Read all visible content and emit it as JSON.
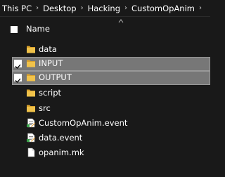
{
  "breadcrumb": {
    "items": [
      "This PC",
      "Desktop",
      "Hacking",
      "CustomOpAnim"
    ],
    "separator": "›"
  },
  "header": {
    "name_label": "Name"
  },
  "files": [
    {
      "name": "data",
      "type": "folder",
      "selected": false
    },
    {
      "name": "INPUT",
      "type": "folder",
      "selected": true
    },
    {
      "name": "OUTPUT",
      "type": "folder",
      "selected": true
    },
    {
      "name": "script",
      "type": "folder",
      "selected": false
    },
    {
      "name": "src",
      "type": "folder",
      "selected": false
    },
    {
      "name": "CustomOpAnim.event",
      "type": "event-file",
      "selected": false
    },
    {
      "name": "data.event",
      "type": "event-file",
      "selected": false
    },
    {
      "name": "opanim.mk",
      "type": "file",
      "selected": false
    }
  ],
  "colors": {
    "background": "#191919",
    "selected_row": "#777777",
    "folder": "#f0c24a",
    "text": "#ffffff"
  }
}
